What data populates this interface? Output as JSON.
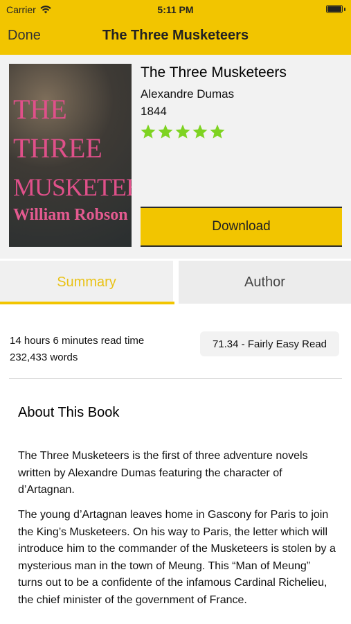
{
  "status_bar": {
    "carrier": "Carrier",
    "time": "5:11 PM"
  },
  "nav": {
    "done_label": "Done",
    "title": "The Three Musketeers"
  },
  "cover": {
    "lines": [
      "THE",
      "THREE",
      "MUSKETEERS",
      "William Robson"
    ]
  },
  "book": {
    "title": "The Three Musketeers",
    "author": "Alexandre Dumas",
    "year": "1844",
    "rating": 5,
    "rating_max": 5,
    "star_color": "#7ed321"
  },
  "download_label": "Download",
  "tabs": {
    "summary": "Summary",
    "author": "Author",
    "active": "summary"
  },
  "stats": {
    "read_time": "14 hours 6 minutes read time",
    "words": "232,433 words",
    "readability": "71.34 - Fairly Easy Read"
  },
  "about": {
    "heading": "About This Book",
    "paragraphs": [
      "The Three Musketeers is the first of three adventure novels written by Alexandre Dumas featuring the character of d’Artagnan.",
      "The young d’Artagnan leaves home in Gascony for Paris to join the King’s Musketeers. On his way to Paris, the letter which will introduce him to the commander of the Musketeers is stolen by a mysterious man in the town of Meung. This “Man of Meung” turns out to be a confidente of the infamous Cardinal Richelieu, the chief minister of the government of France."
    ]
  },
  "colors": {
    "accent": "#f2c500",
    "tab_active_text": "#e9c216"
  }
}
